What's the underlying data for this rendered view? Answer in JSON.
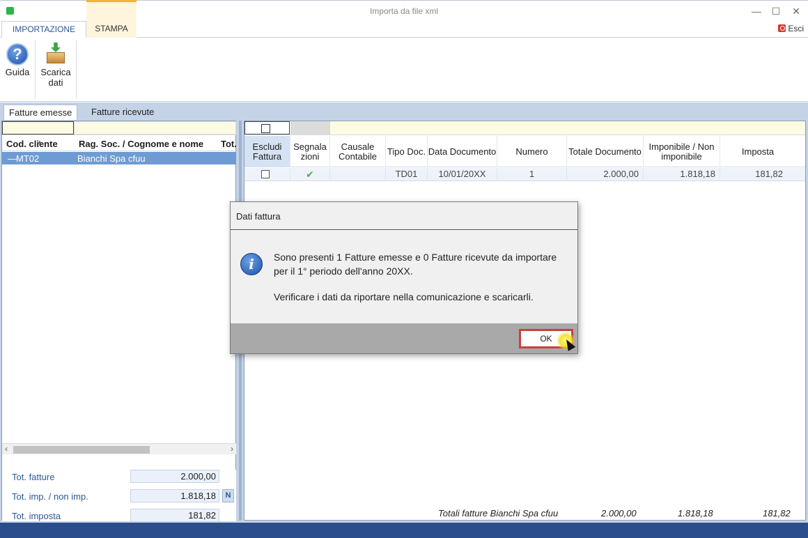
{
  "window": {
    "title": "Importa da file xml",
    "min_glyph": "—",
    "max_glyph": "☐",
    "close_glyph": "✕"
  },
  "ribbon": {
    "tabs": [
      {
        "label": "IMPORTAZIONE",
        "active": true
      },
      {
        "label": "STAMPA",
        "active": false
      }
    ],
    "exit_label": "Esci",
    "buttons": [
      {
        "label": "Guida",
        "icon": "help-icon"
      },
      {
        "label_line1": "Scarica",
        "label_line2": "dati",
        "icon": "download-icon"
      }
    ]
  },
  "subtabs": [
    {
      "label": "Fatture emesse",
      "active": true
    },
    {
      "label": "Fatture ricevute",
      "active": false
    }
  ],
  "left_table": {
    "columns": [
      "Cod. cliente",
      "Rag. Soc. / Cognome e nome",
      "Tot."
    ],
    "rows": [
      {
        "code": "MT02",
        "name": "Bianchi Spa cfuu",
        "selected": true
      }
    ]
  },
  "totals": {
    "fatture_label": "Tot. fatture",
    "fatture_value": "2.000,00",
    "imp_label": "Tot. imp. / non imp.",
    "imp_value": "1.818,18",
    "n_badge": "N",
    "imposta_label": "Tot. imposta",
    "imposta_value": "181,82"
  },
  "grid": {
    "headers": [
      "Escludi Fattura",
      "Segnala zioni",
      "Causale Contabile",
      "Tipo Doc.",
      "Data Documento",
      "Numero",
      "Totale Documento",
      "Imponibile / Non imponibile",
      "Imposta"
    ],
    "row": {
      "escludi": false,
      "segnalazioni": "✔",
      "causale": "",
      "tipo_doc": "TD01",
      "data": "10/01/20XX",
      "numero": "1",
      "totale": "2.000,00",
      "imponibile": "1.818,18",
      "imposta": "181,82"
    },
    "footer": {
      "label": "Totali fatture Bianchi Spa cfuu",
      "totale": "2.000,00",
      "imponibile": "1.818,18",
      "imposta": "181,82"
    }
  },
  "dialog": {
    "title": "Dati fattura",
    "message": "Sono presenti 1 Fatture emesse e 0 Fatture ricevute da importare per il 1° periodo dell'anno 20XX.",
    "message2": "Verificare i dati da riportare nella comunicazione e scaricarli.",
    "ok_label": "OK"
  },
  "colors": {
    "accent": "#2b5797",
    "selected_row": "#6e9bd3",
    "statusbar": "#2b4d8c",
    "ok_border": "#c8423a"
  }
}
